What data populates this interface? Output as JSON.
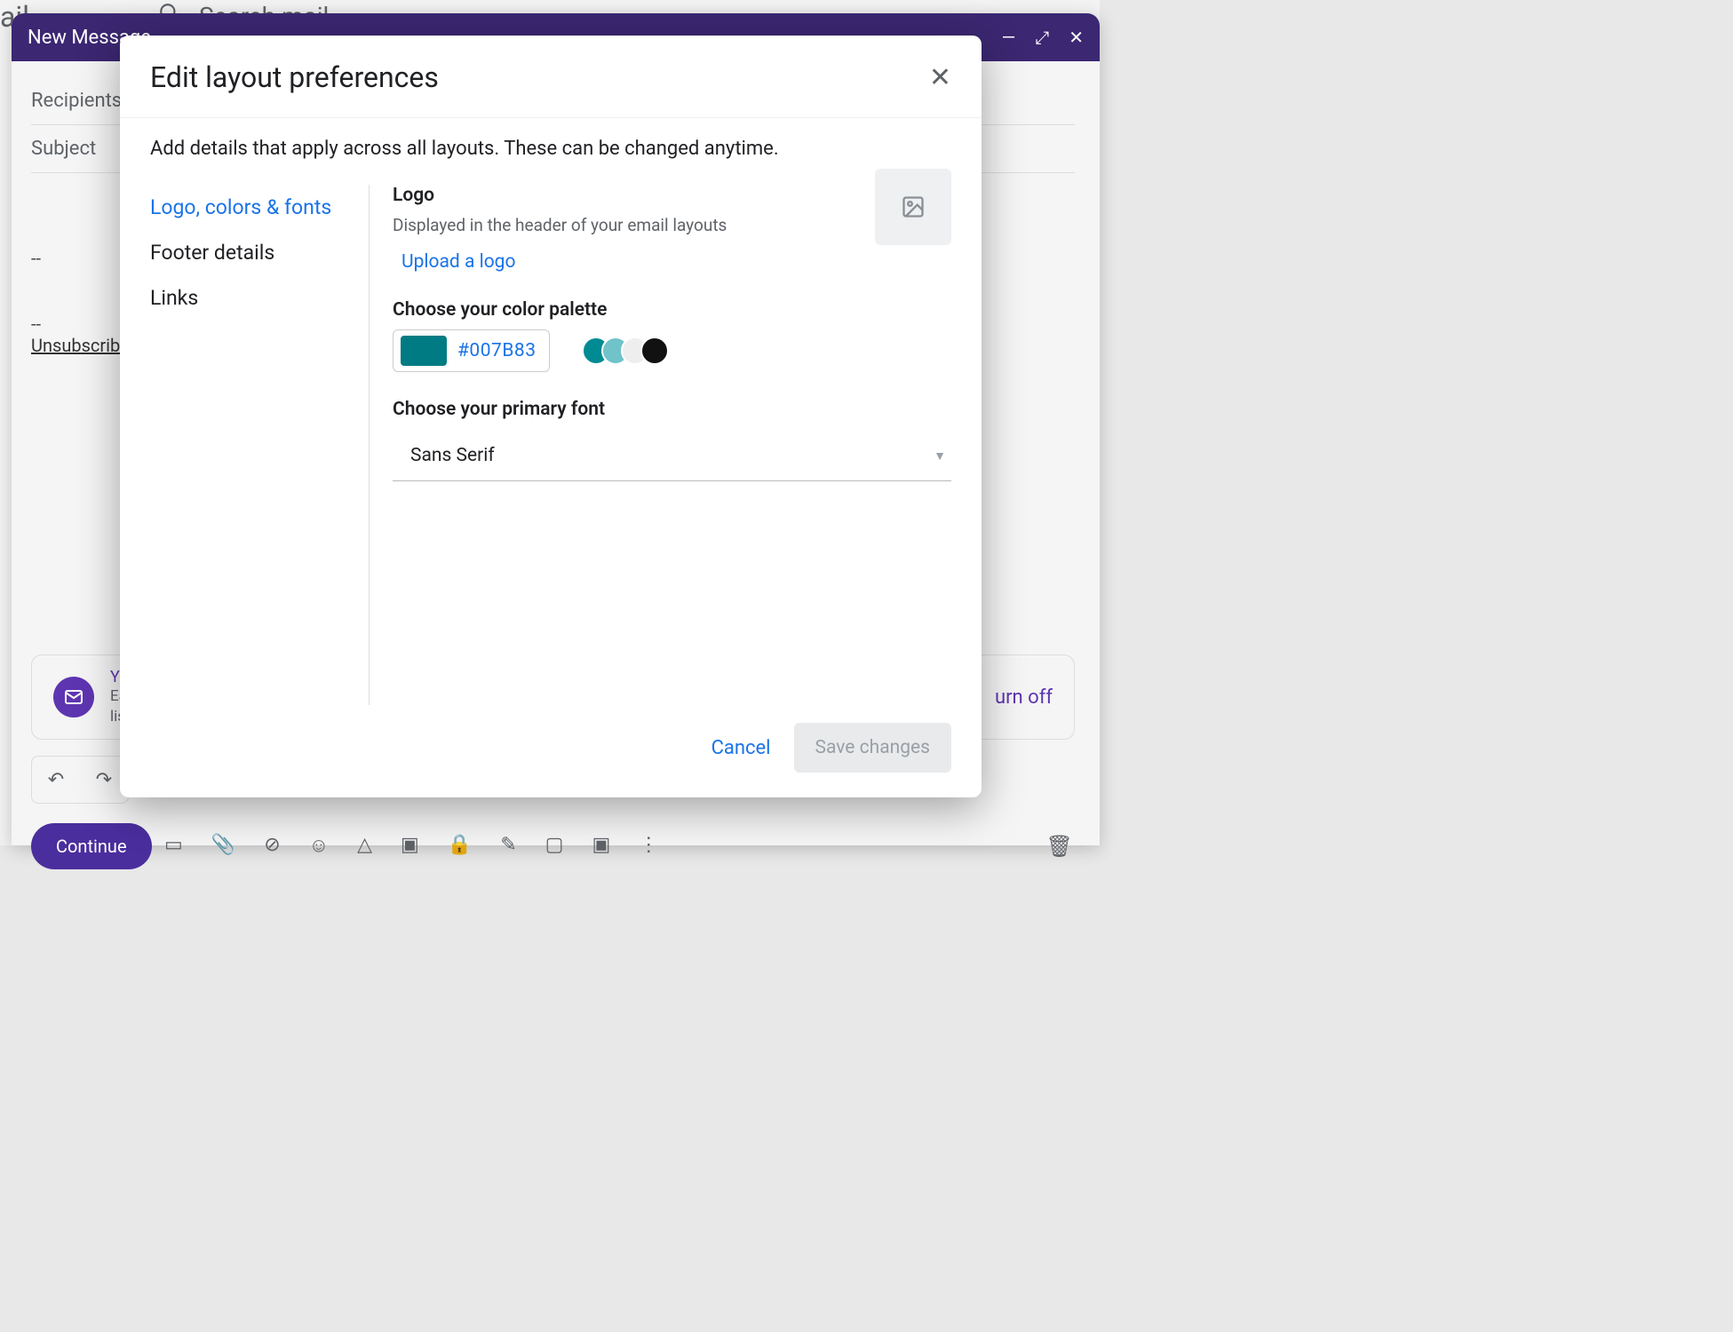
{
  "background": {
    "ail_fragment": "ail",
    "search_placeholder": "Search mail"
  },
  "compose": {
    "title": "New Message",
    "recipients_label": "Recipients",
    "subject_label": "Subject",
    "signature_dashes": "--",
    "unsubscribe_label": "Unsubscribe",
    "mailmerge": {
      "yo": "Yo",
      "line1": "Ea",
      "line2": "lis",
      "turnoff": "urn off"
    },
    "continue_label": "Continue"
  },
  "modal": {
    "title": "Edit layout preferences",
    "subtitle": "Add details that apply across all layouts. These can be changed anytime.",
    "nav": [
      {
        "label": "Logo, colors & fonts",
        "active": true
      },
      {
        "label": "Footer details",
        "active": false
      },
      {
        "label": "Links",
        "active": false
      }
    ],
    "logo": {
      "title": "Logo",
      "desc": "Displayed in the header of your email layouts",
      "upload": "Upload a logo"
    },
    "color": {
      "title": "Choose your color palette",
      "hex": "#007B83",
      "swatch": "#007B83",
      "dots": [
        "#008a92",
        "#6fc3c9",
        "#eeeeee",
        "#111111"
      ]
    },
    "font": {
      "title": "Choose your primary font",
      "value": "Sans Serif"
    },
    "footer": {
      "cancel": "Cancel",
      "save": "Save changes"
    }
  }
}
